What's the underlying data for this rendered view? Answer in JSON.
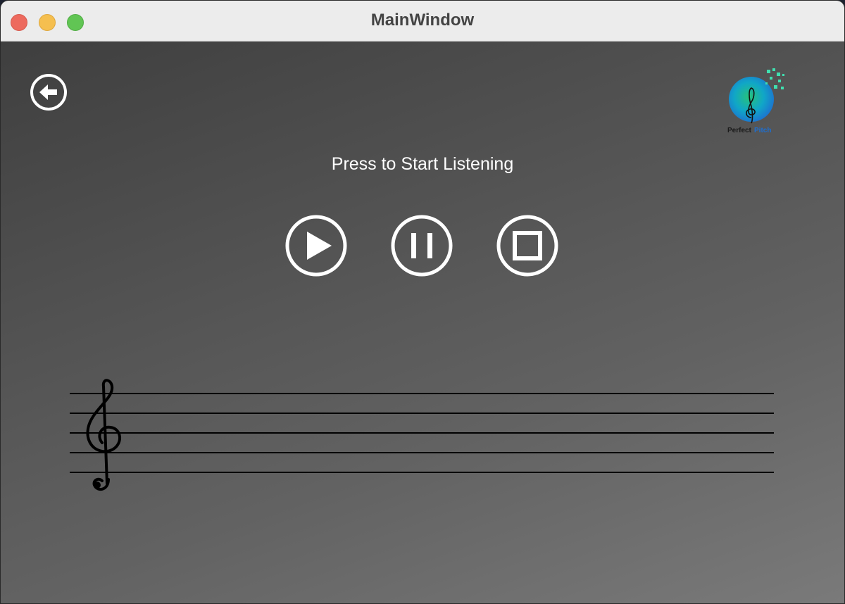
{
  "window": {
    "title": "MainWindow"
  },
  "main": {
    "prompt": "Press to Start Listening",
    "controls": [
      "play",
      "pause",
      "stop"
    ]
  },
  "logo": {
    "text_primary": "Perfect",
    "text_accent": "Pitch",
    "colors": [
      "#1e6fd0",
      "#27c27a",
      "#10a6c8"
    ]
  },
  "icons": {
    "back": "arrow-left-circle-icon",
    "play": "play-circle-icon",
    "pause": "pause-circle-icon",
    "stop": "stop-circle-icon",
    "clef": "treble-clef-icon"
  },
  "staff": {
    "clef": "𝄞",
    "line_count": 5
  }
}
